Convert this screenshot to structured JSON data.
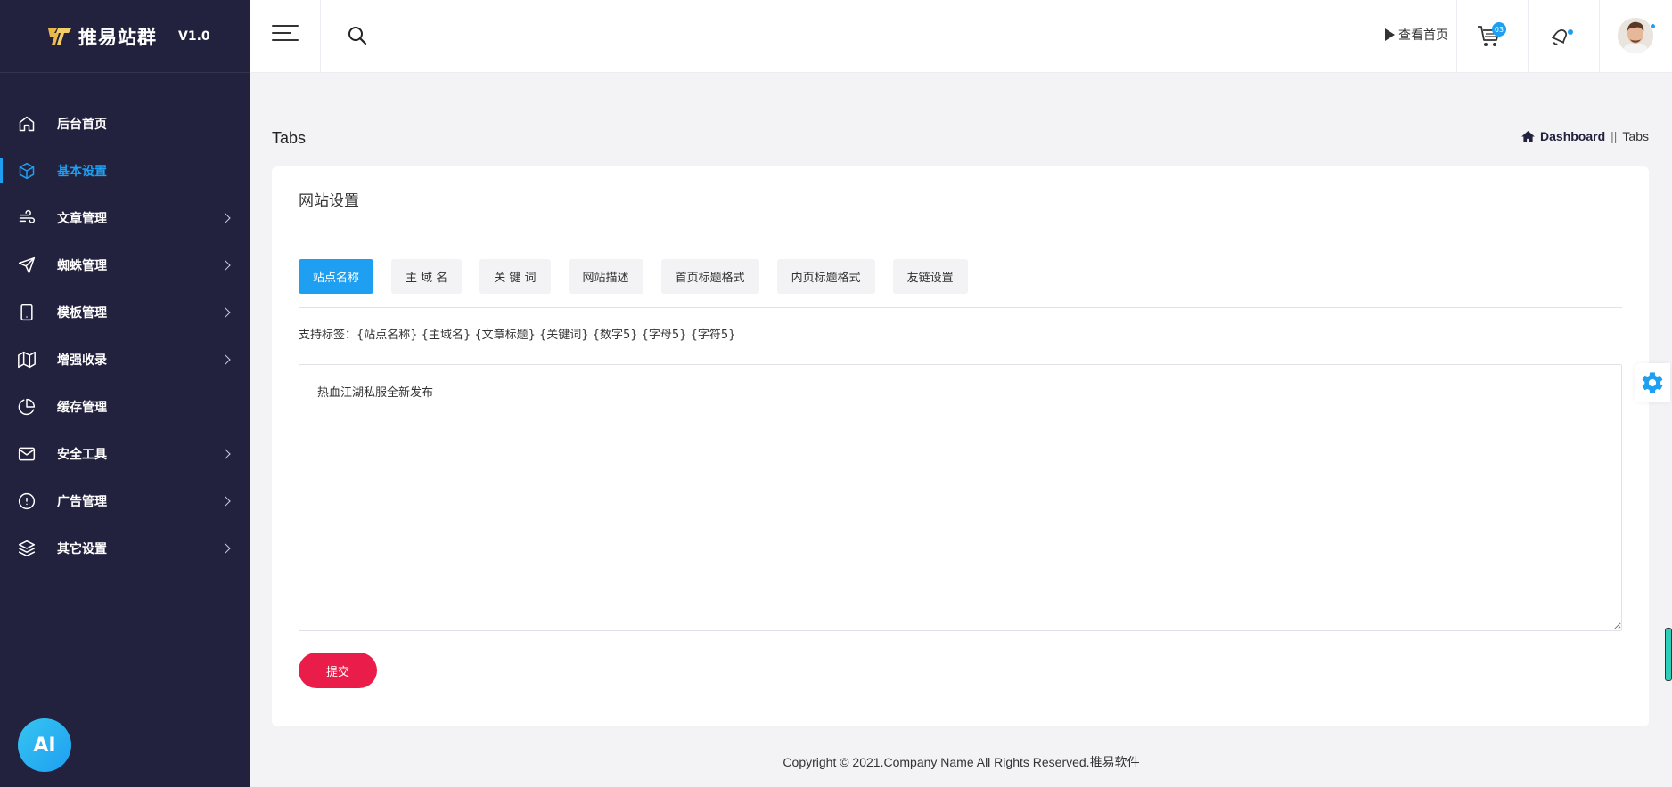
{
  "brand": {
    "name": "推易站群",
    "version": "V1.0"
  },
  "sidebar": {
    "items": [
      {
        "label": "后台首页",
        "icon": "home-icon",
        "has_children": false,
        "active": false
      },
      {
        "label": "基本设置",
        "icon": "cube-icon",
        "has_children": false,
        "active": true
      },
      {
        "label": "文章管理",
        "icon": "wind-icon",
        "has_children": true,
        "active": false
      },
      {
        "label": "蜘蛛管理",
        "icon": "send-icon",
        "has_children": true,
        "active": false
      },
      {
        "label": "模板管理",
        "icon": "tablet-icon",
        "has_children": true,
        "active": false
      },
      {
        "label": "增强收录",
        "icon": "map-icon",
        "has_children": true,
        "active": false
      },
      {
        "label": "缓存管理",
        "icon": "pie-chart-icon",
        "has_children": false,
        "active": false
      },
      {
        "label": "安全工具",
        "icon": "mail-icon",
        "has_children": true,
        "active": false
      },
      {
        "label": "广告管理",
        "icon": "alert-circle-icon",
        "has_children": true,
        "active": false
      },
      {
        "label": "其它设置",
        "icon": "layers-icon",
        "has_children": true,
        "active": false
      }
    ],
    "ai_button": "AI"
  },
  "header": {
    "view_home": "查看首页",
    "cart_count": "03"
  },
  "page": {
    "title": "Tabs",
    "breadcrumb": {
      "home": "Dashboard",
      "separator": "||",
      "current": "Tabs"
    }
  },
  "card": {
    "title": "网站设置",
    "tabs": [
      "站点名称",
      "主 域 名",
      "关 键 词",
      "网站描述",
      "首页标题格式",
      "内页标题格式",
      "友链设置"
    ],
    "active_tab": 0,
    "support_text": "支持标签：{站点名称} {主域名} {文章标题} {关键词} {数字5} {字母5} {字符5}",
    "textarea_value": "热血江湖私服全新发布",
    "submit_label": "提交"
  },
  "footer": {
    "text": "Copyright © 2021.Company Name All Rights Reserved.推易软件"
  },
  "colors": {
    "sidebar_bg": "#23223e",
    "accent": "#1e9ff2",
    "submit": "#ea1d4a",
    "page_bg": "#f3f3f6"
  }
}
